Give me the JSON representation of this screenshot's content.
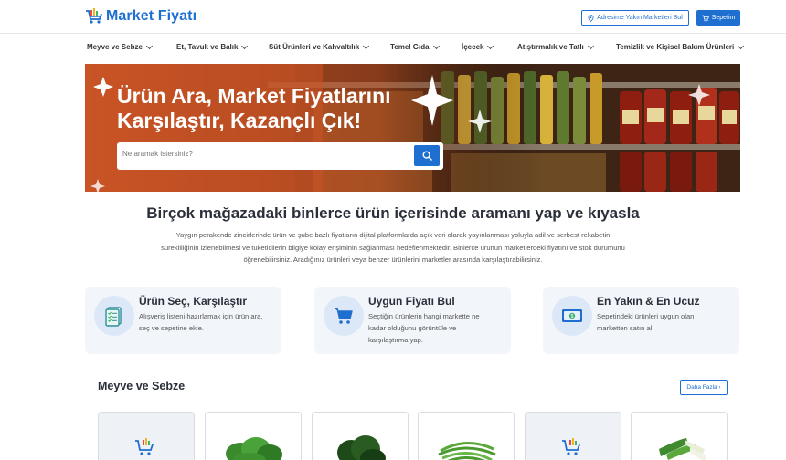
{
  "header": {
    "logo_text": "Market Fiyatı",
    "nearby_button": "Adresime Yakın Marketleri Bul",
    "cart_button": "Sepetim"
  },
  "nav": [
    {
      "label": "Meyve ve Sebze"
    },
    {
      "label": "Et, Tavuk ve Balık"
    },
    {
      "label": "Süt Ürünleri ve Kahvaltılık"
    },
    {
      "label": "Temel Gıda"
    },
    {
      "label": "İçecek"
    },
    {
      "label": "Atıştırmalık ve Tatlı"
    },
    {
      "label": "Temizlik ve Kişisel Bakım Ürünleri"
    }
  ],
  "hero": {
    "title_line1": "Ürün Ara, Market Fiyatlarını",
    "title_line2": "Karşılaştır, Kazançlı Çık!",
    "search_placeholder": "Ne aramak istersiniz?"
  },
  "intro": {
    "title": "Birçok mağazadaki binlerce ürün içerisinde aramanı yap ve kıyasla",
    "line1": "Yaygın perakende zincirlerinde ürün ve şube bazlı fiyatların dijital platformlarda açık veri olarak yayınlanması yoluyla adil ve serbest rekabetin",
    "line2": "sürekliliğinin izlenebilmesi ve tüketicilerin bilgiye kolay erişiminin sağlanması hedeflenmektedir. Binlerce ürünün marketlerdeki fiyatını ve stok durumunu",
    "line3": "öğrenebilirsiniz. Aradığınız ürünleri veya benzer ürünlerini marketler arasında karşılaştırabilirsiniz."
  },
  "features": [
    {
      "title": "Ürün Seç, Karşılaştır",
      "line1": "Alışveriş listeni hazırlamak için ürün ara,",
      "line2": "seç ve sepetine ekle.",
      "line3": "",
      "icon": "checklist-icon"
    },
    {
      "title": "Uygun Fiyatı Bul",
      "line1": "Seçtiğin ürünlerin hangi markette ne",
      "line2": "kadar olduğunu görüntüle ve",
      "line3": "karşılaştırma yap.",
      "icon": "cart-icon"
    },
    {
      "title": "En Yakın & En Ucuz",
      "line1": "Sepetindeki ürünleri uygun olan",
      "line2": "marketten satın al.",
      "line3": "",
      "icon": "money-icon"
    }
  ],
  "section": {
    "title": "Meyve ve Sebze",
    "more_button": "Daha Fazla ›"
  },
  "colors": {
    "brand": "#1f6fd1",
    "feature_bg": "#f2f6fb"
  }
}
